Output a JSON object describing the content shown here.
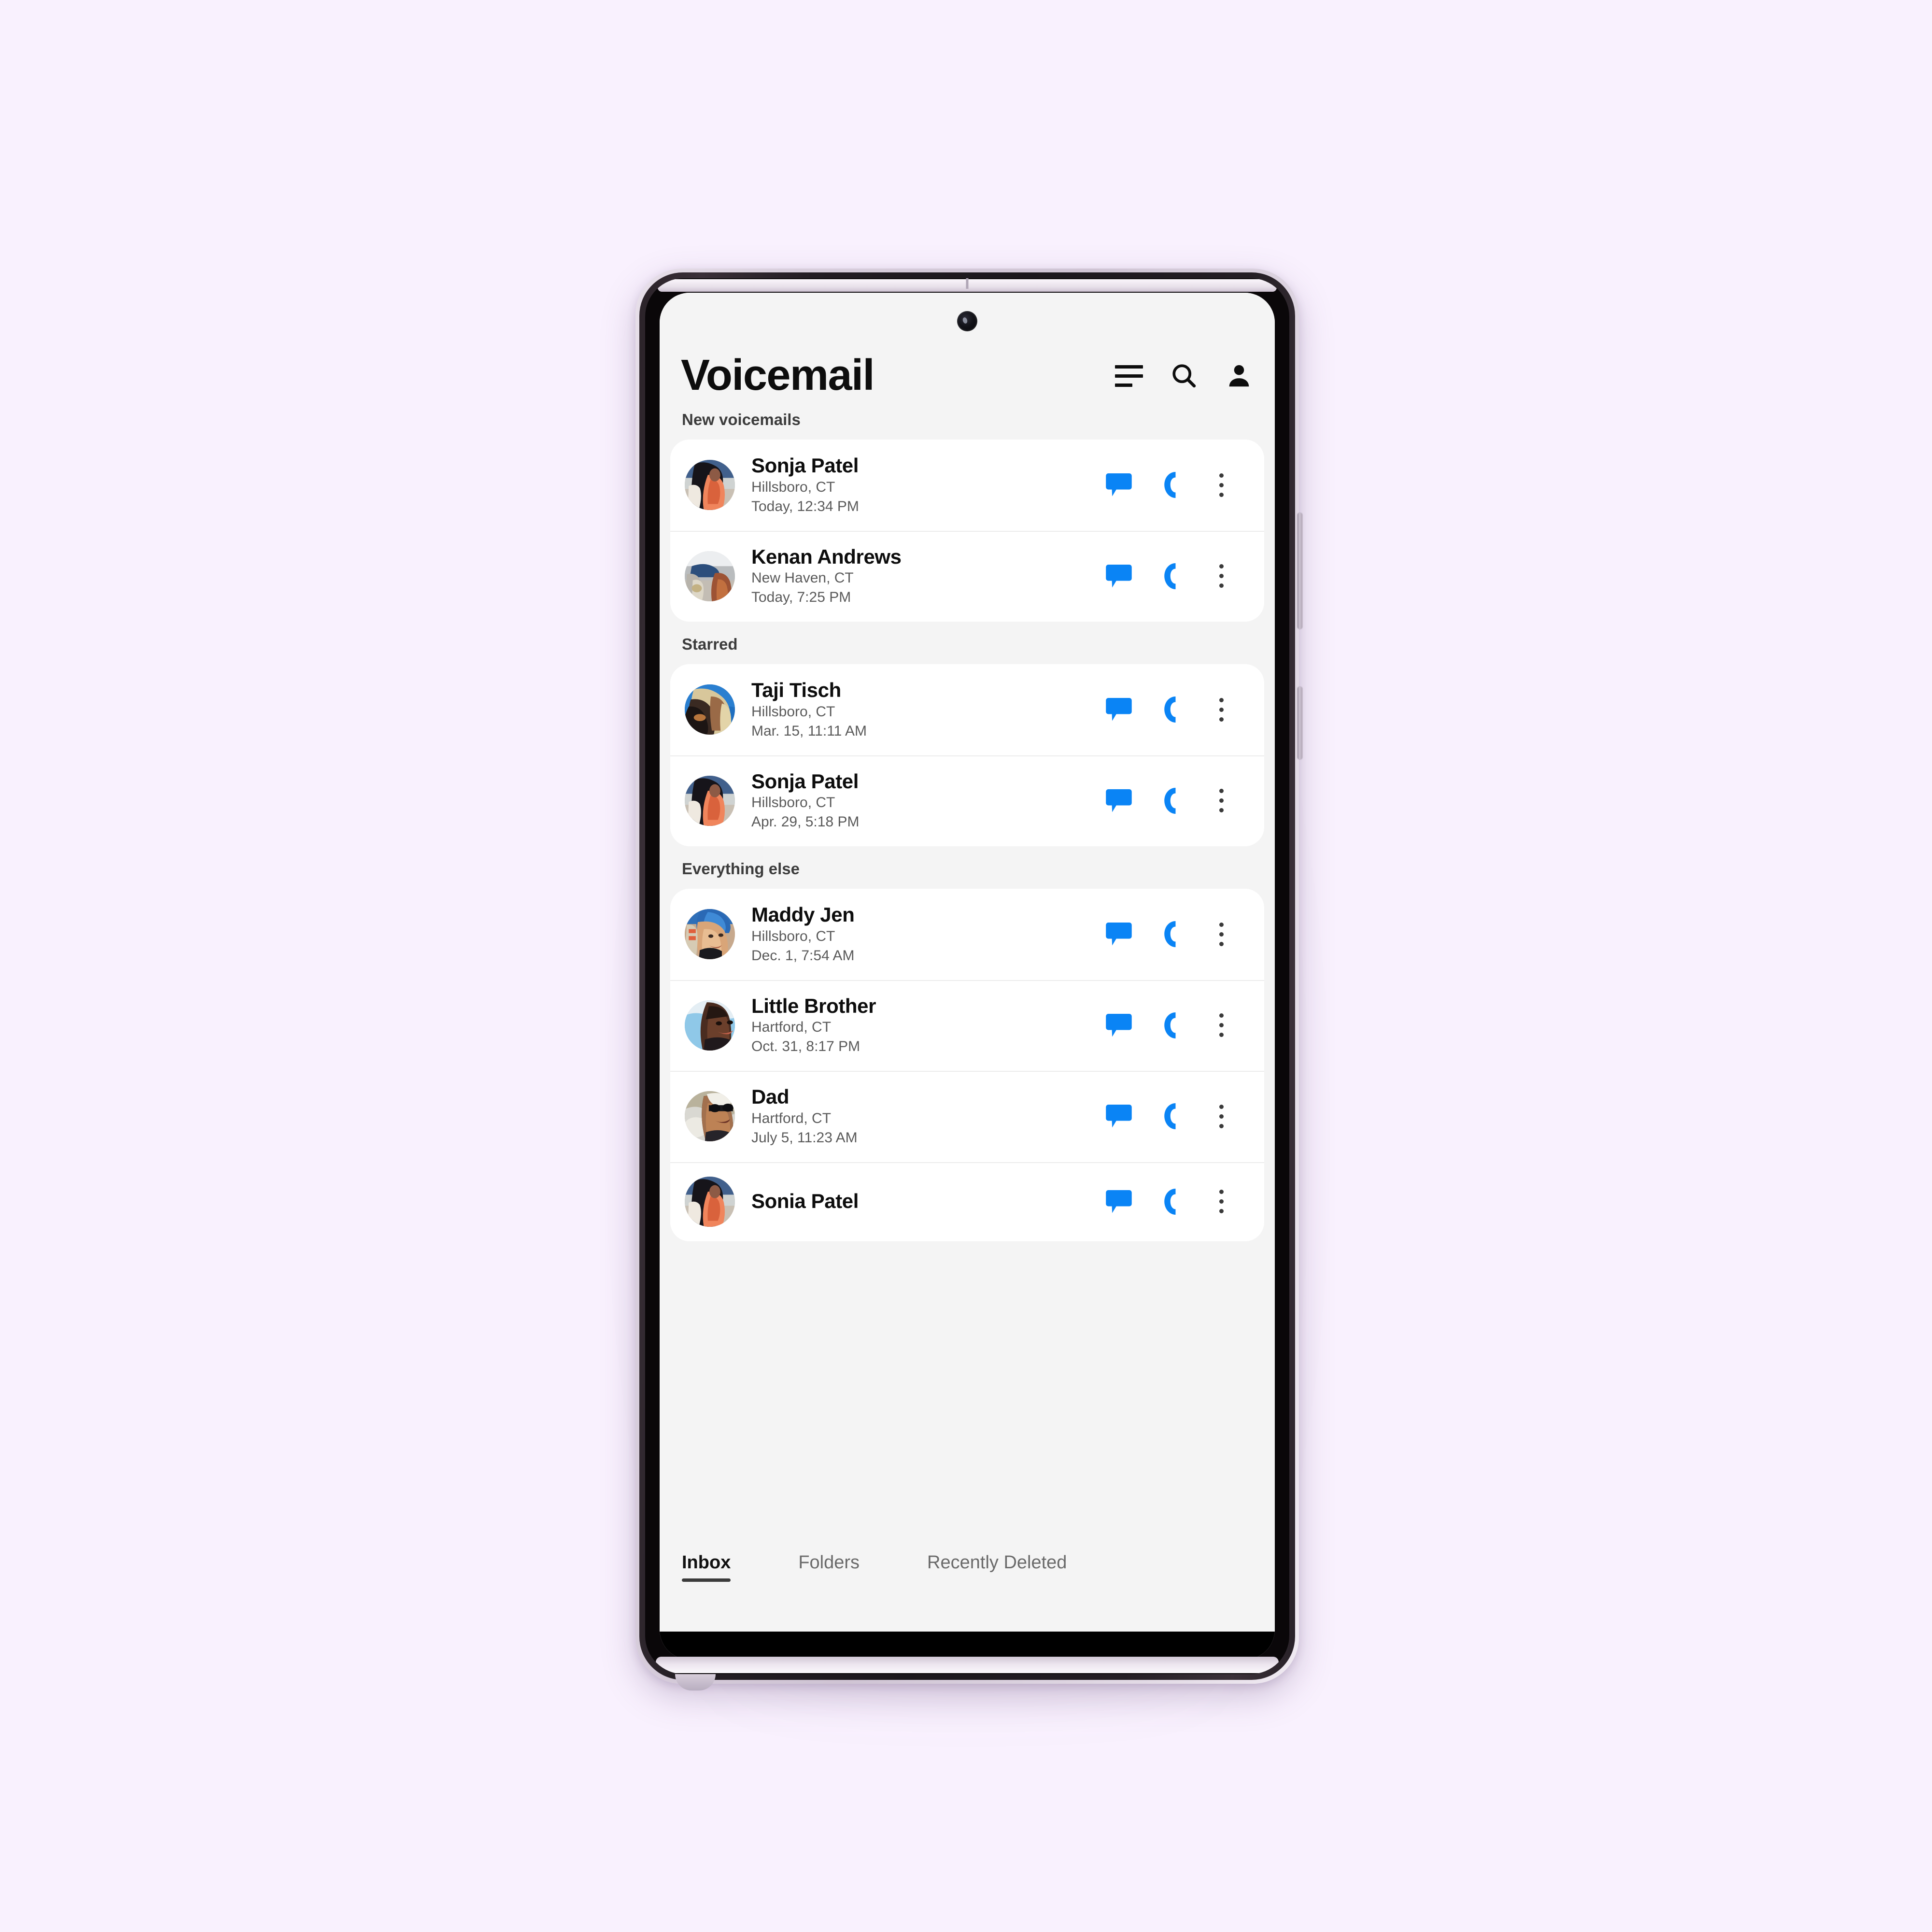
{
  "header": {
    "title": "Voicemail",
    "icons": {
      "sort": "sort-icon",
      "search": "search-icon",
      "profile": "person-icon"
    }
  },
  "colors": {
    "accent_blue": "#0a84f5",
    "page_background": "#f9f1fe",
    "screen_background": "#f4f4f4",
    "card_background": "#ffffff",
    "primary_text": "#0d0d0d",
    "secondary_text": "#5a5a5a",
    "section_text": "#3c3c3c",
    "overflow_dots": "#3a3a3a"
  },
  "sections": [
    {
      "label": "New voicemails",
      "rows": [
        {
          "name": "Sonja Patel",
          "location": "Hillsboro, CT",
          "time": "Today, 12:34 PM",
          "avatar": "sonja"
        },
        {
          "name": "Kenan Andrews",
          "location": "New Haven, CT",
          "time": "Today, 7:25 PM",
          "avatar": "kenan"
        }
      ]
    },
    {
      "label": "Starred",
      "rows": [
        {
          "name": "Taji Tisch",
          "location": "Hillsboro, CT",
          "time": "Mar. 15, 11:11 AM",
          "avatar": "taji"
        },
        {
          "name": "Sonja Patel",
          "location": "Hillsboro, CT",
          "time": "Apr. 29, 5:18 PM",
          "avatar": "sonja"
        }
      ]
    },
    {
      "label": "Everything else",
      "rows": [
        {
          "name": "Maddy Jen",
          "location": "Hillsboro, CT",
          "time": "Dec. 1, 7:54 AM",
          "avatar": "maddy"
        },
        {
          "name": "Little Brother",
          "location": "Hartford, CT",
          "time": "Oct. 31, 8:17 PM",
          "avatar": "brother"
        },
        {
          "name": "Dad",
          "location": "Hartford, CT",
          "time": "July 5, 11:23 AM",
          "avatar": "dad"
        },
        {
          "name": "Sonia Patel",
          "location": "",
          "time": "",
          "avatar": "sonja"
        }
      ]
    }
  ],
  "row_actions": {
    "message": "message-bubble-icon",
    "call": "phone-handset-icon",
    "more": "overflow-menu-icon"
  },
  "tabs": [
    {
      "label": "Inbox",
      "active": true
    },
    {
      "label": "Folders",
      "active": false
    },
    {
      "label": "Recently Deleted",
      "active": false
    }
  ]
}
